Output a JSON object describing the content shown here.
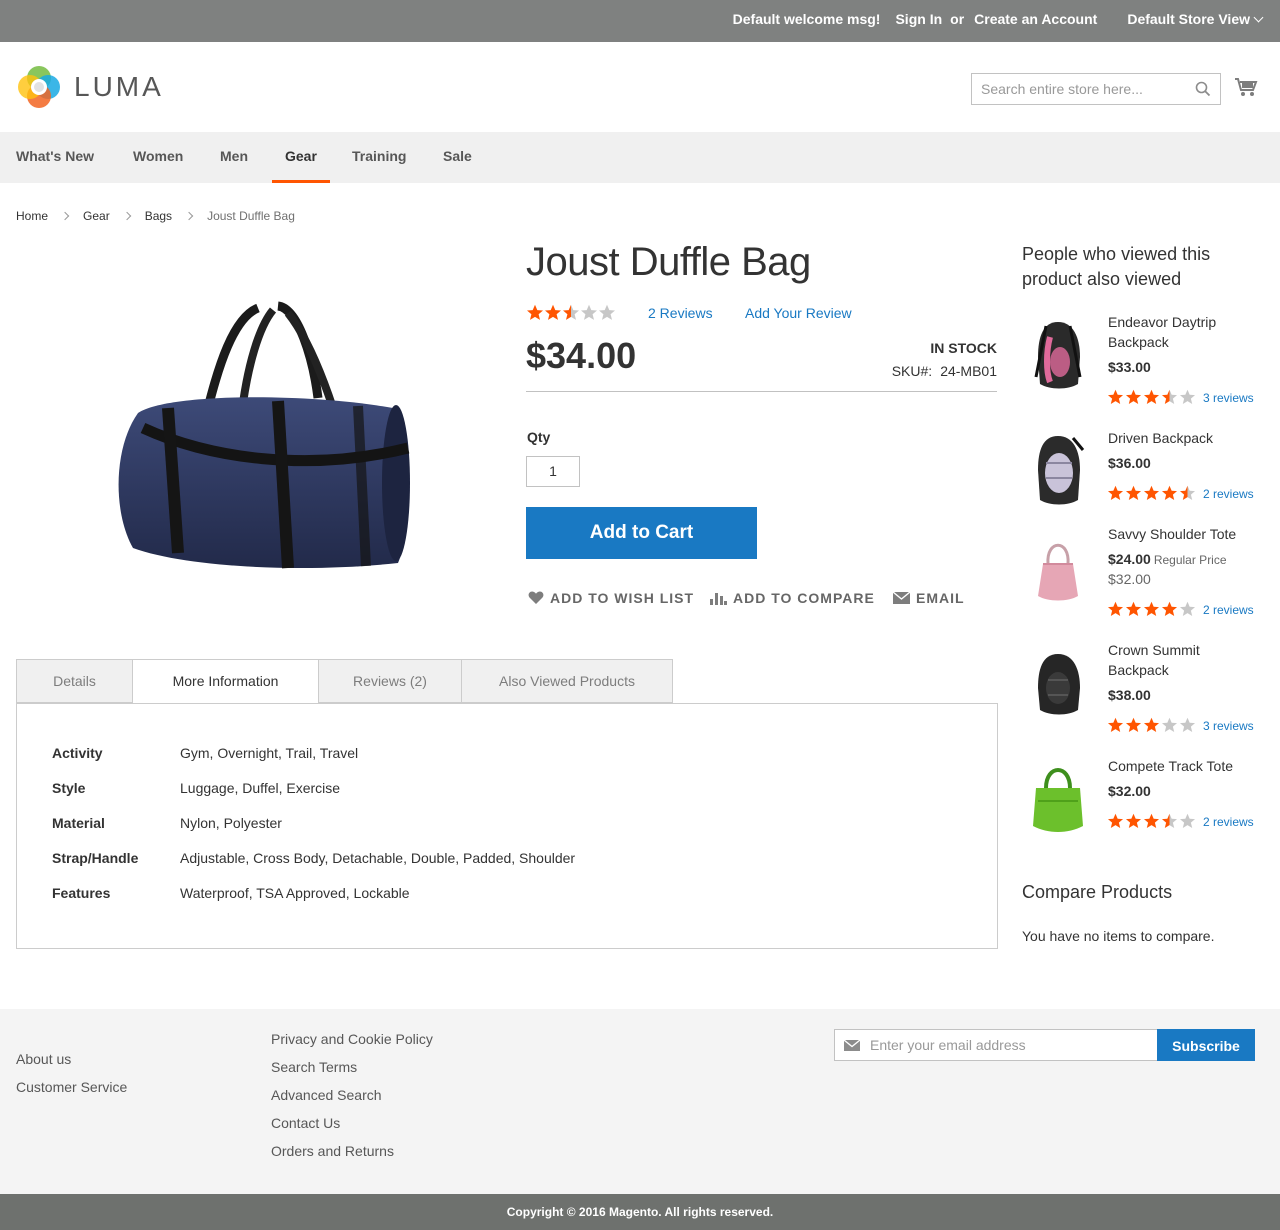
{
  "header": {
    "welcome": "Default welcome msg!",
    "sign_in": "Sign In",
    "or": "or",
    "create_account": "Create an Account",
    "store_view": "Default Store View"
  },
  "logo": {
    "text": "LUMA"
  },
  "search": {
    "placeholder": "Search entire store here..."
  },
  "nav": {
    "items": [
      {
        "label": "What's New"
      },
      {
        "label": "Women"
      },
      {
        "label": "Men"
      },
      {
        "label": "Gear"
      },
      {
        "label": "Training"
      },
      {
        "label": "Sale"
      }
    ],
    "active": "Gear"
  },
  "breadcrumb": [
    "Home",
    "Gear",
    "Bags",
    "Joust Duffle Bag"
  ],
  "product": {
    "name": "Joust Duffle Bag",
    "rating_fraction": 0.5,
    "reviews_link": "2 Reviews",
    "add_review": "Add Your Review",
    "price": "$34.00",
    "stock": "IN STOCK",
    "sku_label": "SKU#:",
    "sku": "24-MB01",
    "qty_label": "Qty",
    "qty_value": "1",
    "add_to_cart": "Add to Cart",
    "wishlist": "ADD TO WISH LIST",
    "compare": "ADD TO COMPARE",
    "email": "EMAIL"
  },
  "tabs": [
    {
      "label": "Details"
    },
    {
      "label": "More Information"
    },
    {
      "label": "Reviews (2)"
    },
    {
      "label": "Also Viewed Products"
    }
  ],
  "specs": [
    {
      "key": "Activity",
      "value": "Gym, Overnight, Trail, Travel"
    },
    {
      "key": "Style",
      "value": "Luggage, Duffel, Exercise"
    },
    {
      "key": "Material",
      "value": "Nylon, Polyester"
    },
    {
      "key": "Strap/Handle",
      "value": "Adjustable, Cross Body, Detachable, Double, Padded, Shoulder"
    },
    {
      "key": "Features",
      "value": "Waterproof, TSA Approved, Lockable"
    }
  ],
  "sidebar": {
    "title": "People who viewed this product also viewed",
    "items": [
      {
        "name": "Endeavor Daytrip Backpack",
        "price": "$33.00",
        "rating": 3.5,
        "reviews": "3 reviews"
      },
      {
        "name": "Driven Backpack",
        "price": "$36.00",
        "rating": 4.5,
        "reviews": "2 reviews"
      },
      {
        "name": "Savvy Shoulder Tote",
        "price": "$24.00",
        "regular_label": "Regular Price",
        "old_price": "$32.00",
        "rating": 4,
        "reviews": "2 reviews"
      },
      {
        "name": "Crown Summit Backpack",
        "price": "$38.00",
        "rating": 3,
        "reviews": "3 reviews"
      },
      {
        "name": "Compete Track Tote",
        "price": "$32.00",
        "rating": 3.5,
        "reviews": "2 reviews"
      }
    ]
  },
  "compare": {
    "title": "Compare Products",
    "empty": "You have no items to compare."
  },
  "footer": {
    "col1": [
      "About us",
      "Customer Service"
    ],
    "col2": [
      "Privacy and Cookie Policy",
      "Search Terms",
      "Advanced Search",
      "Contact Us",
      "Orders and Returns"
    ],
    "newsletter_placeholder": "Enter your email address",
    "subscribe": "Subscribe",
    "copyright": "Copyright © 2016 Magento. All rights reserved."
  },
  "colors": {
    "accent": "#1979c3",
    "star": "#ff5501",
    "star_empty": "#c7c7c7",
    "topbar": "#7f8180"
  }
}
